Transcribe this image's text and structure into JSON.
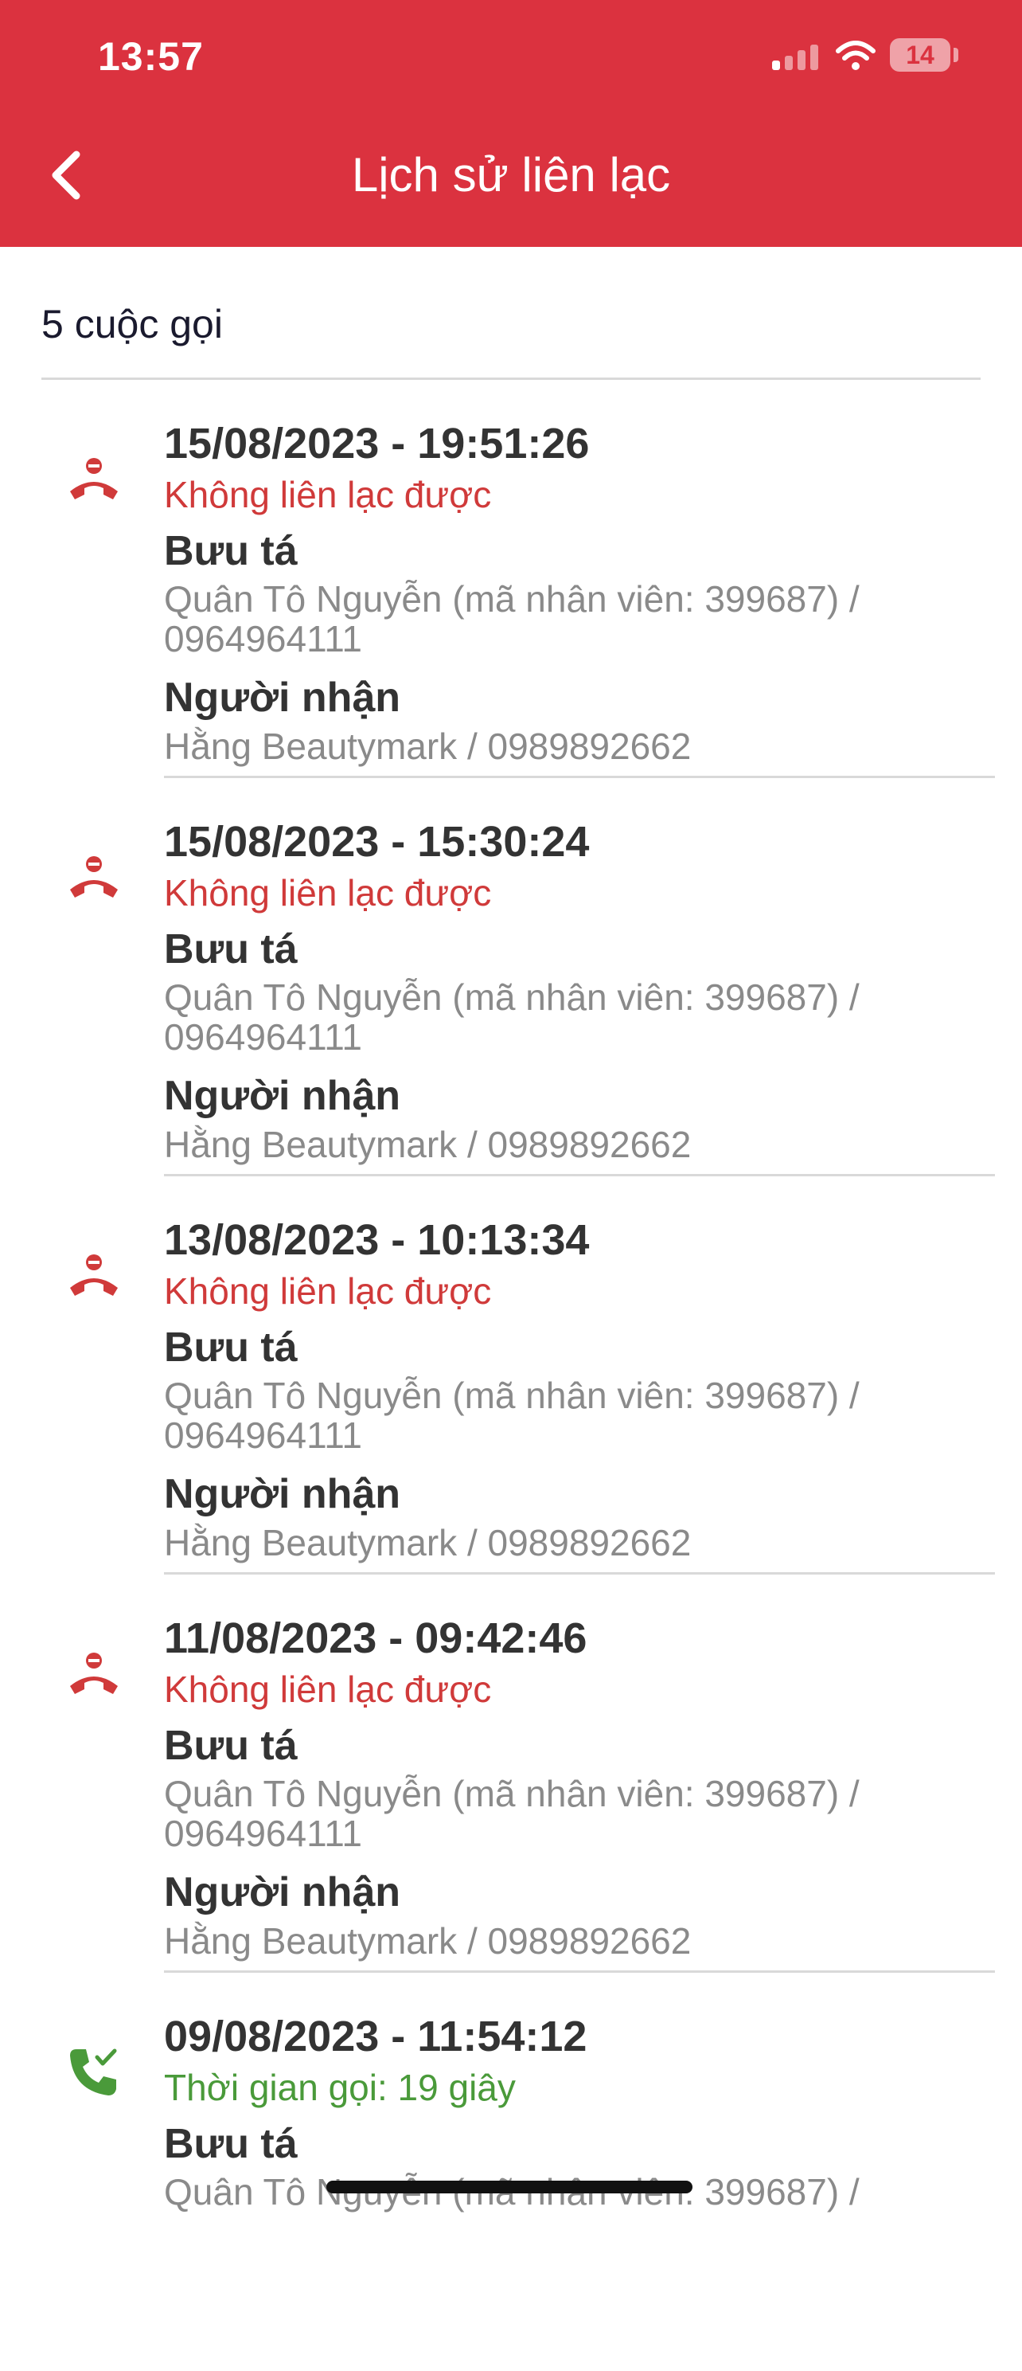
{
  "status_bar": {
    "time": "13:57",
    "battery": "14"
  },
  "header": {
    "title": "Lịch sử liên lạc"
  },
  "summary": {
    "count_text": "5 cuộc gọi"
  },
  "colors": {
    "header_bg": "#DB323F",
    "fail": "#D03A3A",
    "success": "#4A9A3A"
  },
  "calls": [
    {
      "icon": "missed-call-icon",
      "datetime": "15/08/2023 - 19:51:26",
      "status": "Không liên lạc được",
      "postman_label": "Bưu tá",
      "postman": "Quân Tô Nguyễn (mã nhân viên: 399687) / 0964964111",
      "recipient_label": "Người nhận",
      "recipient": "Hằng Beautymark / 0989892662"
    },
    {
      "icon": "missed-call-icon",
      "datetime": "15/08/2023 - 15:30:24",
      "status": "Không liên lạc được",
      "postman_label": "Bưu tá",
      "postman": "Quân Tô Nguyễn (mã nhân viên: 399687) / 0964964111",
      "recipient_label": "Người nhận",
      "recipient": "Hằng Beautymark / 0989892662"
    },
    {
      "icon": "missed-call-icon",
      "datetime": "13/08/2023 - 10:13:34",
      "status": "Không liên lạc được",
      "postman_label": "Bưu tá",
      "postman": "Quân Tô Nguyễn (mã nhân viên: 399687) / 0964964111",
      "recipient_label": "Người nhận",
      "recipient": "Hằng Beautymark / 0989892662"
    },
    {
      "icon": "missed-call-icon",
      "datetime": "11/08/2023 - 09:42:46",
      "status": "Không liên lạc được",
      "postman_label": "Bưu tá",
      "postman": "Quân Tô Nguyễn (mã nhân viên: 399687) / 0964964111",
      "recipient_label": "Người nhận",
      "recipient": "Hằng Beautymark / 0989892662"
    },
    {
      "icon": "call-connected-icon",
      "datetime": "09/08/2023 - 11:54:12",
      "status": "Thời gian gọi: 19 giây",
      "postman_label": "Bưu tá",
      "postman": "Quân Tô Nguyễn (mã nhân viên: 399687) /",
      "recipient_label": "",
      "recipient": ""
    }
  ]
}
